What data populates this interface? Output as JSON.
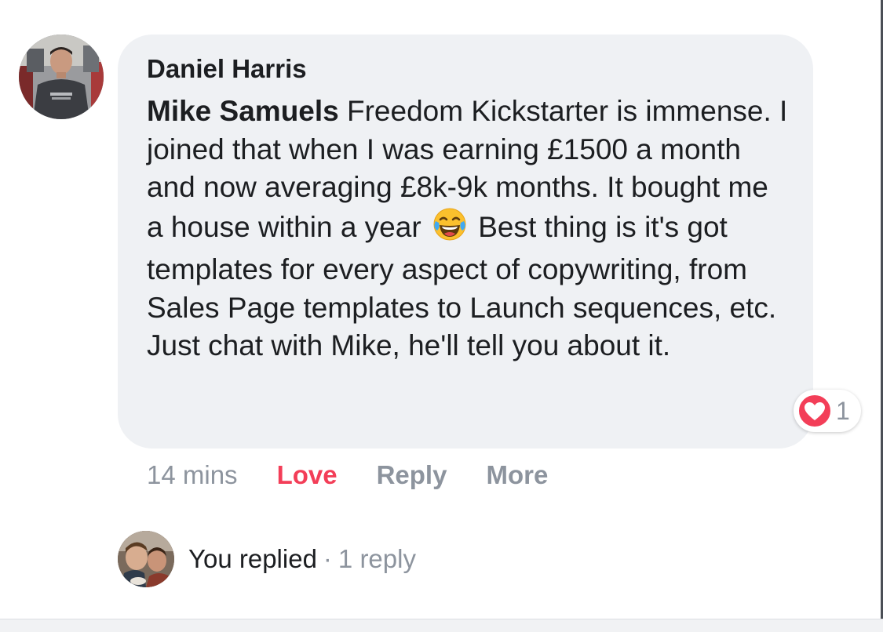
{
  "comment": {
    "author": "Daniel Harris",
    "mention": "Mike Samuels",
    "text_before_emoji": " Freedom Kickstarter is immense. I joined that when I was earning £1500 a month and now averaging £8k-9k months. It bought me a house within a year",
    "emoji": "tears-of-joy-emoji",
    "text_after_emoji": "Best thing is it's got templates for every aspect of copywriting, from Sales Page templates to Launch sequences, etc. Just chat with Mike, he'll tell you about it.",
    "reaction_count": "1",
    "reaction_icon": "heart-icon",
    "reaction_color": "#f33e58"
  },
  "actions": {
    "time": "14 mins",
    "love": "Love",
    "reply": "Reply",
    "more": "More"
  },
  "reply_summary": {
    "label": "You replied",
    "separator": "·",
    "count": "1 reply"
  }
}
